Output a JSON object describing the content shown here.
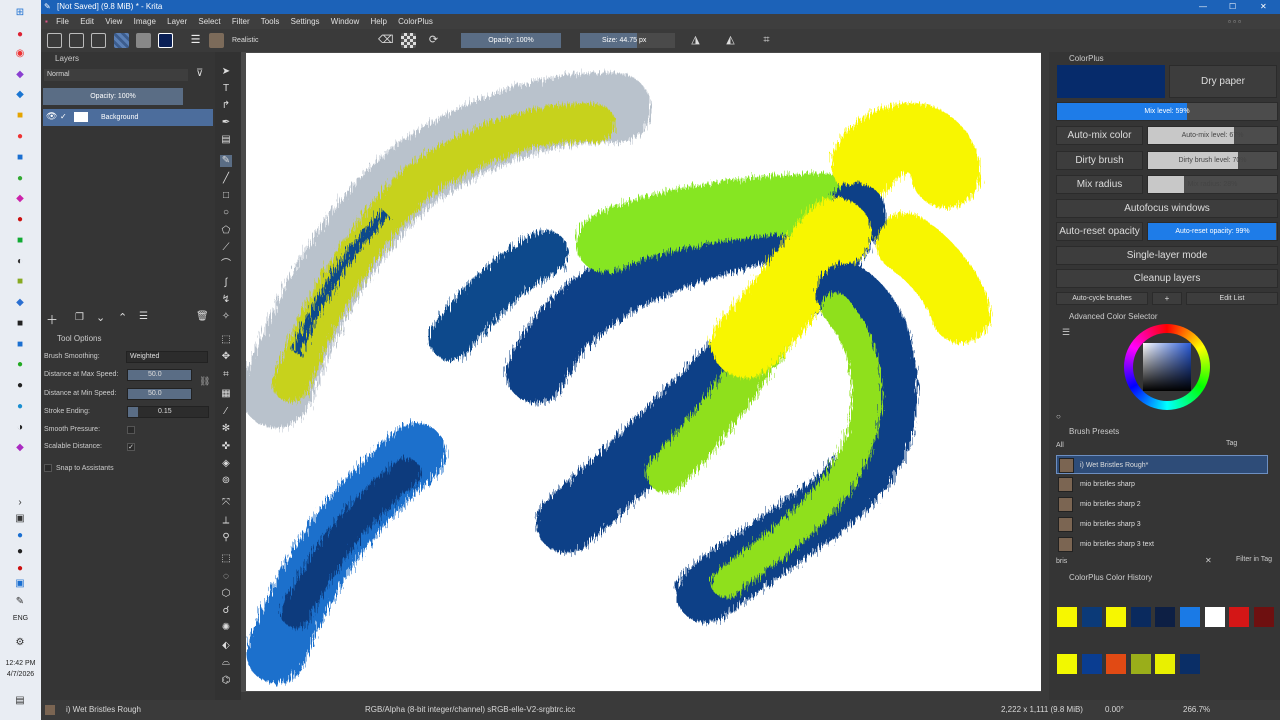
{
  "window": {
    "title": "[Not Saved]  (9.8 MiB) * - Krita",
    "controls": {
      "minimize": "—",
      "maximize": "☐",
      "close": "✕"
    }
  },
  "menu": [
    "File",
    "Edit",
    "View",
    "Image",
    "Layer",
    "Select",
    "Filter",
    "Tools",
    "Settings",
    "Window",
    "Help",
    "ColorPlus"
  ],
  "toolbar": {
    "blend_mode": "Realistic",
    "opacity": "Opacity: 100%",
    "size": "Size: 44.75 px"
  },
  "layers": {
    "title": "Layers",
    "blend": "Normal",
    "opacity": "Opacity: 100%",
    "items": [
      {
        "name": "Background"
      }
    ]
  },
  "tool_options": {
    "title": "Tool Options",
    "brush_smoothing_label": "Brush Smoothing:",
    "brush_smoothing_value": "Weighted",
    "dist_max_label": "Distance at Max Speed:",
    "dist_max_value": "50.0",
    "dist_min_label": "Distance at Min Speed:",
    "dist_min_value": "50.0",
    "stroke_ending_label": "Stroke Ending:",
    "stroke_ending_value": "0.15",
    "smooth_pressure_label": "Smooth Pressure:",
    "scalable_distance_label": "Scalable Distance:",
    "snap_label": "Snap to Assistants"
  },
  "colorplus": {
    "title": "ColorPlus",
    "dry_paper": "Dry paper",
    "mix_level": "Mix level: 59%",
    "mix_level_value": 0.59,
    "auto_mix": "Auto-mix color",
    "auto_mix_level": "Auto-mix level: 67%",
    "auto_mix_value": 0.67,
    "dirty_brush": "Dirty brush",
    "dirty_level": "Dirty brush level: 70%",
    "dirty_value": 0.7,
    "mix_radius": "Mix radius",
    "mix_radius_level": "Mix radius: 28%",
    "mix_radius_value": 0.28,
    "autofocus": "Autofocus windows",
    "auto_reset": "Auto-reset opacity",
    "auto_reset_level": "Auto-reset opacity: 99%",
    "auto_reset_value": 0.99,
    "single_layer": "Single-layer mode",
    "cleanup": "Cleanup layers",
    "auto_cycle": "Auto-cycle brushes",
    "plus": "+",
    "edit_list": "Edit List",
    "current_color": "#062b6b"
  },
  "color_selector": {
    "title": "Advanced Color Selector"
  },
  "brush_presets": {
    "title": "Brush Presets",
    "filter": "All",
    "tag": "Tag",
    "items": [
      "i) Wet Bristles Rough*",
      "mio bristles sharp",
      "mio bristles sharp 2",
      "mio bristles sharp 3",
      "mio bristles sharp 3 text"
    ],
    "search": "bris",
    "filter_in_tag": "Filter in Tag"
  },
  "color_history": {
    "title": "ColorPlus Color History",
    "row1": [
      "#f7f700",
      "#0b3a78",
      "#f7f700",
      "#0a2a5e",
      "#0d1f44",
      "#1a7ae6",
      "#ffffff",
      "#d41616",
      "#6e1010"
    ],
    "row2": [
      "#f2f800",
      "#0a3d91",
      "#e14a14",
      "#9aae1a",
      "#e9f000",
      "#0a2e66"
    ]
  },
  "status": {
    "brush": "i) Wet Bristles Rough",
    "colorspace": "RGB/Alpha (8-bit integer/channel)  sRGB-elle-V2-srgbtrc.icc",
    "dimensions": "2,222 x 1,111 (9.8 MiB)",
    "rotation": "0.00°",
    "zoom": "266.7%"
  },
  "clock": {
    "time": "12:42 PM",
    "date": "4/7/2026",
    "lang": "ENG"
  }
}
